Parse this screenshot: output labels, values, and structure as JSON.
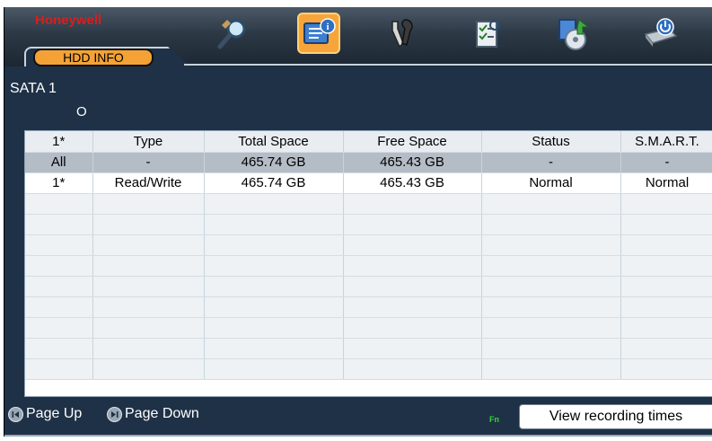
{
  "header": {
    "brand": "Honeywell",
    "tab_label": "HDD INFO"
  },
  "toolbar": {
    "icons": [
      {
        "name": "search-icon"
      },
      {
        "name": "info-icon",
        "selected": true
      },
      {
        "name": "tools-icon"
      },
      {
        "name": "checklist-icon"
      },
      {
        "name": "backup-icon"
      },
      {
        "name": "shutdown-icon"
      }
    ]
  },
  "disk": {
    "interface_label": "SATA 1",
    "indicator": "O"
  },
  "table": {
    "columns": [
      "1*",
      "Type",
      "Total Space",
      "Free Space",
      "Status",
      "S.M.A.R.T."
    ],
    "rows": [
      [
        "All",
        "-",
        "465.74 GB",
        "465.43 GB",
        "-",
        "-"
      ],
      [
        "1*",
        "Read/Write",
        "465.74 GB",
        "465.43 GB",
        "Normal",
        "Normal"
      ]
    ]
  },
  "footer": {
    "page_up": "Page Up",
    "page_down": "Page Down",
    "fn": "Fn",
    "view_recording_times": "View recording times"
  },
  "colors": {
    "background": "#1f3146",
    "accent": "#f4a236",
    "brand": "#d81e1e",
    "fn": "#32d633"
  }
}
